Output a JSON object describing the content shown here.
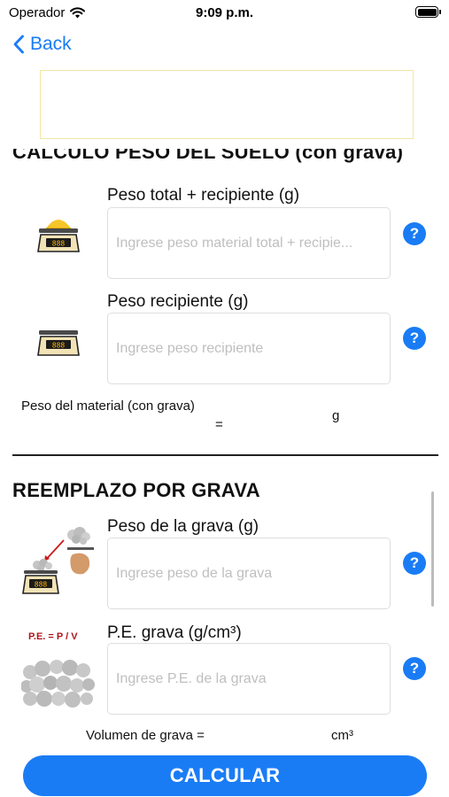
{
  "status_bar": {
    "carrier": "Operador",
    "time": "9:09 p.m."
  },
  "nav": {
    "back_label": "Back"
  },
  "section1": {
    "title": "CALCULO PESO DEL SUELO (con grava)",
    "field_total": {
      "label": "Peso total + recipiente (g)",
      "placeholder": "Ingrese peso material total + recipie..."
    },
    "field_recipiente": {
      "label": "Peso recipiente (g)",
      "placeholder": "Ingrese peso recipiente"
    },
    "result": {
      "label": "Peso del material (con grava)",
      "equals": "=",
      "unit": "g"
    }
  },
  "section2": {
    "title": "REEMPLAZO POR GRAVA",
    "field_grava": {
      "label": "Peso de la grava (g)",
      "placeholder": "Ingrese peso de la grava"
    },
    "field_pe": {
      "label": "P.E. grava (g/cm³)",
      "placeholder": "Ingrese P.E. de la grava"
    },
    "formula_text": "P.E. = P / V",
    "result": {
      "label": "Volumen de grava =",
      "unit": "cm³"
    }
  },
  "help_symbol": "?",
  "scale_display": "888",
  "calculate_button": "CALCULAR",
  "colors": {
    "accent": "#1a7cf5",
    "ad_border": "#f3e6a3",
    "formula_red": "#b0151b"
  }
}
